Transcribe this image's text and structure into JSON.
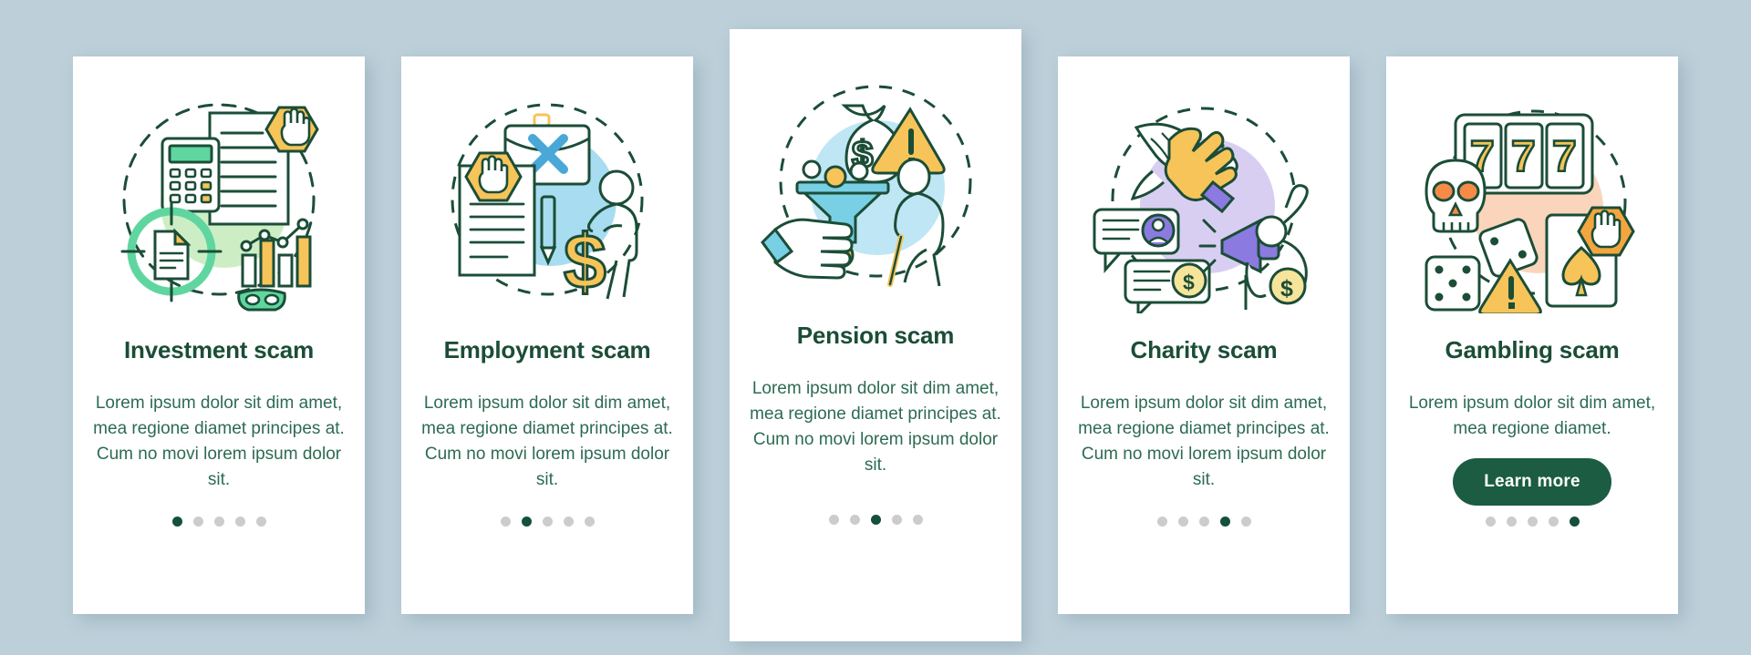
{
  "page": {
    "background_color": "#bdd0da",
    "card_background": "#ffffff",
    "title_color": "#1b4d37",
    "body_color": "#2d6b52",
    "accent_color": "#1b5c42",
    "dot_inactive_color": "#cccccc",
    "dot_active_color": "#15503a"
  },
  "screens": [
    {
      "title": "Investment scam",
      "body": "Lorem ipsum dolor sit dim amet, mea regione diamet principes at. Cum no movi lorem ipsum dolor sit.",
      "illustration": "investment-scam-illustration",
      "circle_color": "#cdeec4",
      "dots": {
        "count": 5,
        "active": 1
      },
      "cta": null
    },
    {
      "title": "Employment scam",
      "body": "Lorem ipsum dolor sit dim amet, mea regione diamet principes at. Cum no movi lorem ipsum dolor sit.",
      "illustration": "employment-scam-illustration",
      "circle_color": "#a8dcf0",
      "dots": {
        "count": 5,
        "active": 2
      },
      "cta": null
    },
    {
      "title": "Pension scam",
      "body": "Lorem ipsum dolor sit dim amet, mea regione diamet principes at. Cum no movi lorem ipsum dolor sit.",
      "illustration": "pension-scam-illustration",
      "circle_color": "#bfe6f4",
      "dots": {
        "count": 5,
        "active": 3
      },
      "cta": null
    },
    {
      "title": "Charity scam",
      "body": "Lorem ipsum dolor sit dim amet, mea regione diamet principes at. Cum no movi lorem ipsum dolor sit.",
      "illustration": "charity-scam-illustration",
      "circle_color": "#d8cef2",
      "dots": {
        "count": 5,
        "active": 4
      },
      "cta": null
    },
    {
      "title": "Gambling scam",
      "body": "Lorem ipsum dolor sit dim amet, mea regione diamet.",
      "illustration": "gambling-scam-illustration",
      "circle_color": "#fad5bb",
      "dots": {
        "count": 5,
        "active": 5
      },
      "cta": "Learn more"
    }
  ]
}
